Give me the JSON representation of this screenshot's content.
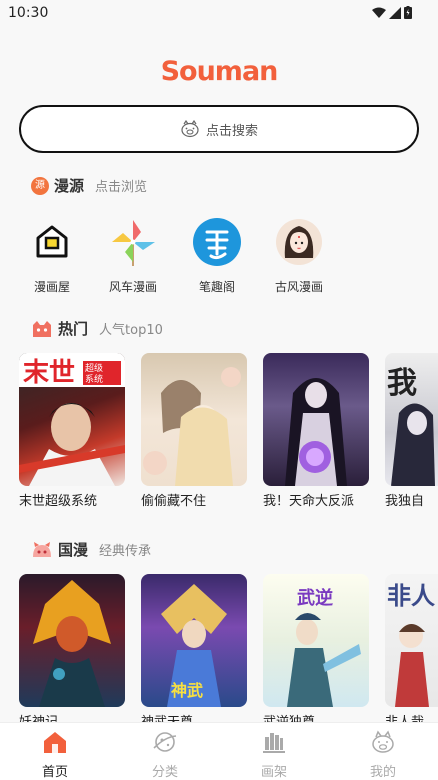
{
  "status": {
    "time": "10:30"
  },
  "app": {
    "logo": "Souman",
    "accent": "#f2603c"
  },
  "search": {
    "placeholder": "点击搜索"
  },
  "sources_section": {
    "badge": "源",
    "title": "漫源",
    "subtitle": "点击浏览",
    "items": [
      {
        "label": "漫画屋",
        "icon": "house-icon"
      },
      {
        "label": "风车漫画",
        "icon": "pinwheel-icon"
      },
      {
        "label": "笔趣阁",
        "icon": "bi-icon"
      },
      {
        "label": "古风漫画",
        "icon": "ancient-girl-icon"
      }
    ]
  },
  "hot_section": {
    "title": "热门",
    "subtitle": "人气top10",
    "items": [
      {
        "title": "末世超级系统"
      },
      {
        "title": "偷偷藏不住"
      },
      {
        "title": "我！天命大反派"
      },
      {
        "title": "我独自"
      }
    ]
  },
  "guoman_section": {
    "title": "国漫",
    "subtitle": "经典传承",
    "items": [
      {
        "title": "妖神记"
      },
      {
        "title": "神武天尊"
      },
      {
        "title": "武逆独尊"
      },
      {
        "title": "非人哉"
      }
    ]
  },
  "tabbar": {
    "items": [
      {
        "label": "首页",
        "active": true
      },
      {
        "label": "分类"
      },
      {
        "label": "画架"
      },
      {
        "label": "我的"
      }
    ]
  }
}
